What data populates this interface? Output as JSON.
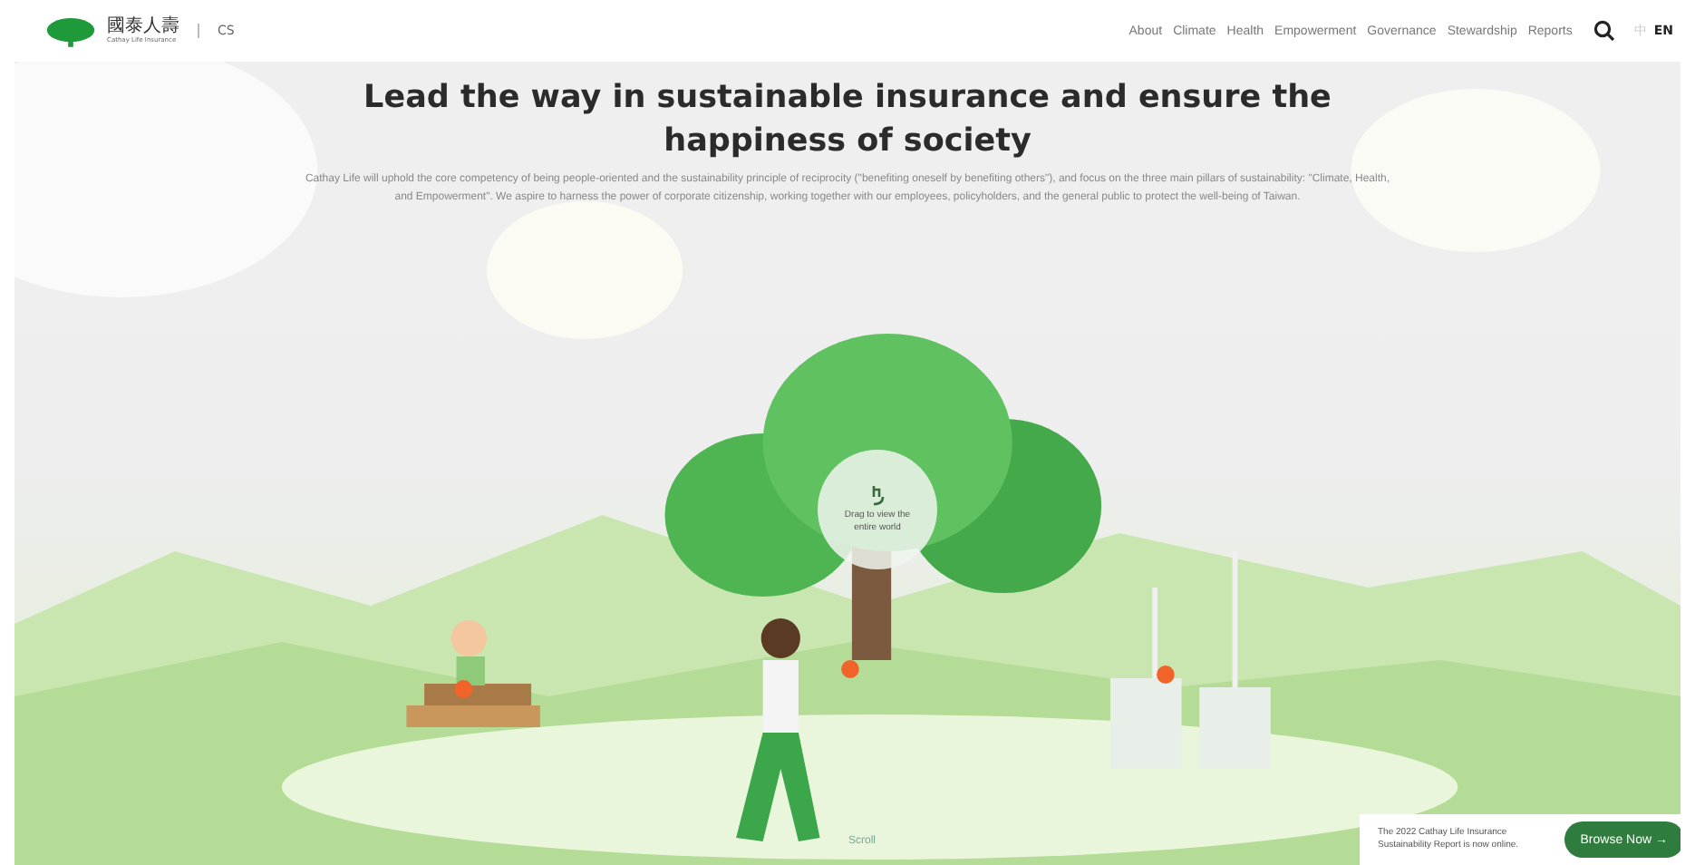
{
  "header": {
    "logo": {
      "name": "國泰人壽",
      "subtitle": "Cathay Life Insurance"
    },
    "section": "CS",
    "nav": [
      "About",
      "Climate",
      "Health",
      "Empowerment",
      "Governance",
      "Stewardship",
      "Reports"
    ],
    "languages": [
      {
        "label": "中",
        "selected": false
      },
      {
        "label": "EN",
        "selected": true
      }
    ]
  },
  "hero": {
    "title": "Lead the way in sustainable insurance and ensure the happiness of society",
    "description": "Cathay Life will uphold the core competency of being people-oriented and the sustainability principle of reciprocity (\"benefiting oneself by benefiting others\"), and focus on the three main pillars of sustainability: \"Climate, Health, and Empowerment\". We aspire to harness the power of corporate citizenship, working together with our employees, policyholders, and the general public to protect the well-being of Taiwan.",
    "drag_hint": "Drag to view the entire world",
    "scroll": "Scroll"
  },
  "notice": {
    "text": "The 2022 Cathay Life Insurance Sustainability Report is now online.",
    "button": "Browse Now →"
  }
}
